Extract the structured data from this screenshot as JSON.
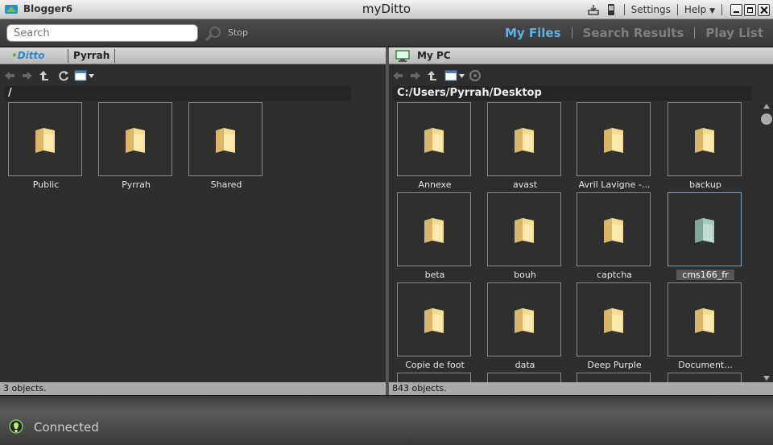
{
  "window": {
    "user": "Blogger6",
    "title": "myDitto",
    "settings_label": "Settings",
    "help_label": "Help"
  },
  "toolbar": {
    "search_placeholder": "Search",
    "stop_label": "Stop",
    "tabs": [
      {
        "label": "My Files",
        "active": true
      },
      {
        "label": "Search Results",
        "active": false
      },
      {
        "label": "Play List",
        "active": false
      }
    ]
  },
  "left_pane": {
    "logo_text": "Ditto",
    "tab_label": "Pyrrah",
    "path": "/",
    "items": [
      "Public",
      "Pyrrah",
      "Shared"
    ],
    "status": "3 objects."
  },
  "right_pane": {
    "title": "My PC",
    "path": "C:/Users/Pyrrah/Desktop",
    "items": [
      "Annexe",
      "avast",
      "Avril Lavigne -...",
      "backup",
      "beta",
      "bouh",
      "captcha",
      "cms166_fr",
      "Copie de foot",
      "data",
      "Deep Purple",
      "Document..."
    ],
    "selected": "cms166_fr",
    "status": "843 objects."
  },
  "footer": {
    "status": "Connected"
  },
  "colors": {
    "accent": "#5eb1e3",
    "folder": "#f2d98a",
    "folder_selected": "#9fc3b8"
  }
}
